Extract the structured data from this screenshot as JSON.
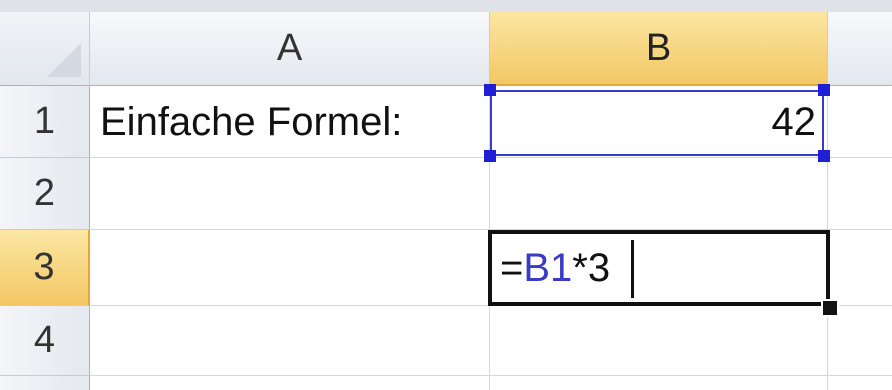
{
  "columns": [
    "A",
    "B"
  ],
  "rows": [
    "1",
    "2",
    "3",
    "4"
  ],
  "cells": {
    "A1": "Einfache Formel:",
    "B1": "42"
  },
  "editing_cell": {
    "address": "B3",
    "formula_prefix": "=",
    "formula_ref": "B1",
    "formula_suffix": "*3"
  },
  "selection": {
    "active_column": "B",
    "active_row": "3",
    "referenced_cell": "B1"
  },
  "colors": {
    "reference_blue": "#3a3ac4",
    "header_highlight": "#f3c764",
    "grid_line": "#d4d8de"
  }
}
